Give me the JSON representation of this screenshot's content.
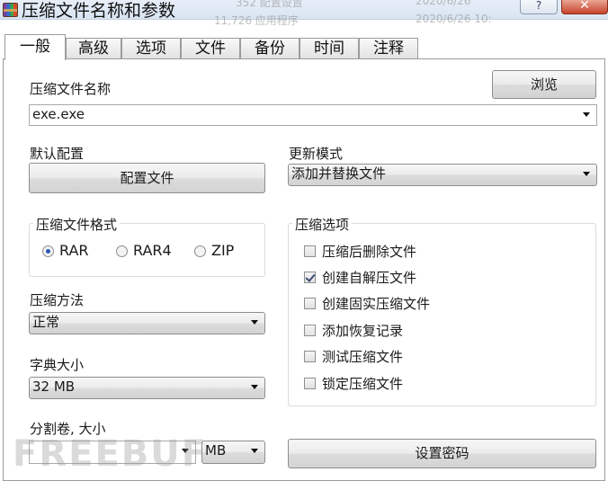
{
  "window": {
    "title": "压缩文件名称和参数",
    "ghost_rows": [
      "352 配置设置",
      "2020/6/26",
      "11,726 应用程序",
      "2020/6/26 10:"
    ],
    "help_glyph": "?",
    "close_glyph": "✕"
  },
  "tabs": [
    "一般",
    "高级",
    "选项",
    "文件",
    "备份",
    "时间",
    "注释"
  ],
  "archive_name": {
    "label": "压缩文件名称",
    "value": "exe.exe",
    "browse_label": "浏览"
  },
  "profile": {
    "label": "默认配置",
    "button_label": "配置文件"
  },
  "update_mode": {
    "label": "更新模式",
    "value": "添加并替换文件"
  },
  "format": {
    "legend": "压缩文件格式",
    "options": [
      "RAR",
      "RAR4",
      "ZIP"
    ],
    "selected": "RAR"
  },
  "options": {
    "legend": "压缩选项",
    "items": [
      {
        "label": "压缩后删除文件",
        "checked": false
      },
      {
        "label": "创建自解压文件",
        "checked": true
      },
      {
        "label": "创建固实压缩文件",
        "checked": false
      },
      {
        "label": "添加恢复记录",
        "checked": false
      },
      {
        "label": "测试压缩文件",
        "checked": false
      },
      {
        "label": "锁定压缩文件",
        "checked": false
      }
    ]
  },
  "method": {
    "label": "压缩方法",
    "value": "正常"
  },
  "dictionary": {
    "label": "字典大小",
    "value": "32 MB"
  },
  "split": {
    "label": "分割卷, 大小",
    "unit": "MB"
  },
  "password_label": "设置密码",
  "watermark": "FREEBUF"
}
